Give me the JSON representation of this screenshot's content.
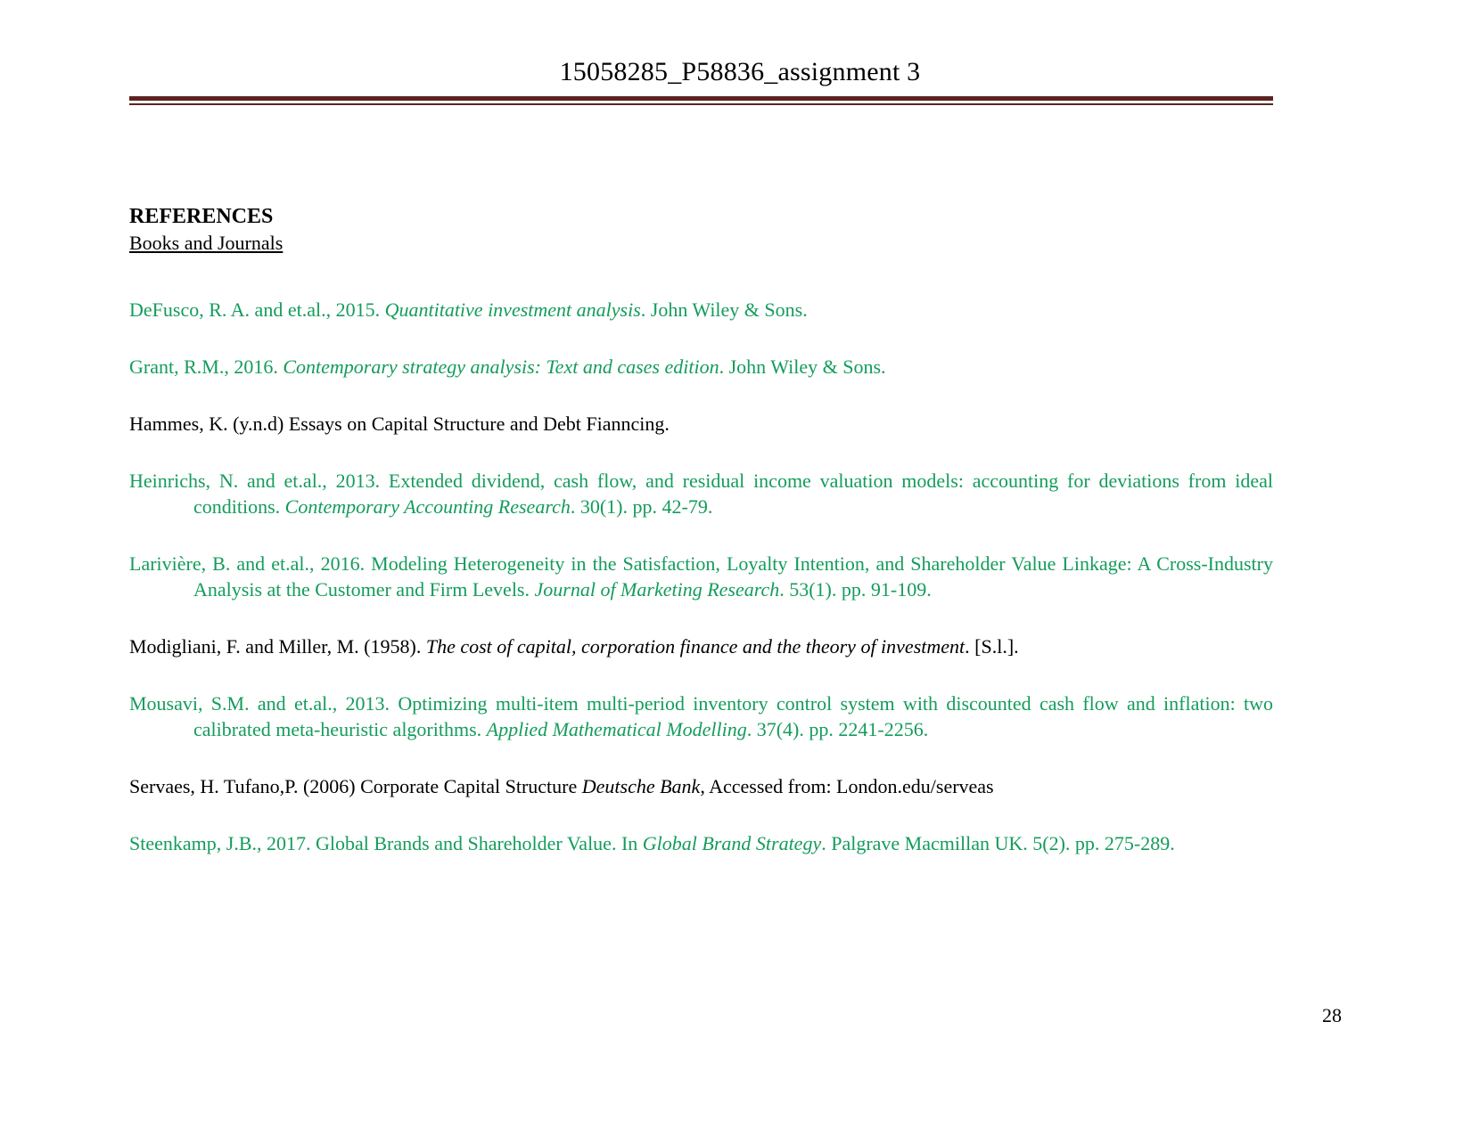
{
  "document": {
    "header": {
      "title": "15058285_P58836_assignment 3",
      "rule_color": "#5B2321"
    },
    "section": {
      "heading": "REFERENCES",
      "subheading": "Books and Journals"
    },
    "colors": {
      "green_text": "#149C5B",
      "black_text": "#000000",
      "rule_maroon": "#5B2321",
      "page_background": "#FFFFFF"
    },
    "references": [
      {
        "id": "ref-defusco",
        "color": "green",
        "parts": [
          {
            "text": "DeFusco, R. A. and et.al., 2015. ",
            "style": "normal"
          },
          {
            "text": "Quantitative investment analysis",
            "style": "italic"
          },
          {
            "text": ". John Wiley & Sons.",
            "style": "normal"
          }
        ]
      },
      {
        "id": "ref-grant",
        "color": "green",
        "parts": [
          {
            "text": "Grant, R.M., 2016. ",
            "style": "normal"
          },
          {
            "text": "Contemporary strategy analysis: Text and cases edition",
            "style": "italic"
          },
          {
            "text": ". John Wiley & Sons.",
            "style": "normal"
          }
        ]
      },
      {
        "id": "ref-hammes",
        "color": "black",
        "parts": [
          {
            "text": "Hammes, K. (y.n.d) Essays on Capital Structure and Debt Fianncing.",
            "style": "normal"
          }
        ]
      },
      {
        "id": "ref-heinrichs",
        "color": "green",
        "parts": [
          {
            "text": "Heinrichs, N. and et.al., 2013. Extended dividend, cash flow, and residual income valuation models: accounting for deviations from ideal conditions. ",
            "style": "normal"
          },
          {
            "text": "Contemporary Accounting Research",
            "style": "italic"
          },
          {
            "text": ". 30(1). pp. 42-79.",
            "style": "normal"
          }
        ]
      },
      {
        "id": "ref-lariviere",
        "color": "green",
        "parts": [
          {
            "text": "Larivière, B. and et.al., 2016. Modeling Heterogeneity in the Satisfaction, Loyalty Intention, and Shareholder Value Linkage: A Cross-Industry Analysis at the Customer and Firm Levels. ",
            "style": "normal"
          },
          {
            "text": "Journal of Marketing Research",
            "style": "italic"
          },
          {
            "text": ". 53(1). pp. 91-109.",
            "style": "normal"
          }
        ]
      },
      {
        "id": "ref-modigliani",
        "color": "black",
        "parts": [
          {
            "text": "Modigliani, F. and Miller, M. (1958). ",
            "style": "normal"
          },
          {
            "text": "The cost of capital, corporation finance and the theory of investment",
            "style": "italic"
          },
          {
            "text": ". [S.l.].",
            "style": "normal"
          }
        ]
      },
      {
        "id": "ref-mousavi",
        "color": "green",
        "parts": [
          {
            "text": "Mousavi, S.M. and et.al., 2013. Optimizing multi-item multi-period inventory control system with discounted cash flow and inflation: two calibrated meta-heuristic algorithms. ",
            "style": "normal"
          },
          {
            "text": "Applied Mathematical Modelling",
            "style": "italic"
          },
          {
            "text": ". 37(4). pp. 2241-2256.",
            "style": "normal"
          }
        ]
      },
      {
        "id": "ref-servaes",
        "color": "black",
        "parts": [
          {
            "text": "Servaes, H. Tufano,P. (2006) Corporate Capital Structure ",
            "style": "normal"
          },
          {
            "text": "Deutsche Bank",
            "style": "italic"
          },
          {
            "text": ", Accessed from: London.edu/serveas",
            "style": "normal"
          }
        ]
      },
      {
        "id": "ref-steenkamp",
        "color": "green",
        "parts": [
          {
            "text": "Steenkamp, J.B., 2017. Global Brands and Shareholder Value. In ",
            "style": "normal"
          },
          {
            "text": "Global Brand Strategy",
            "style": "italic"
          },
          {
            "text": ". Palgrave Macmillan UK. 5(2). pp. 275-289.",
            "style": "normal"
          }
        ]
      }
    ],
    "footer": {
      "page_number": "28"
    }
  }
}
